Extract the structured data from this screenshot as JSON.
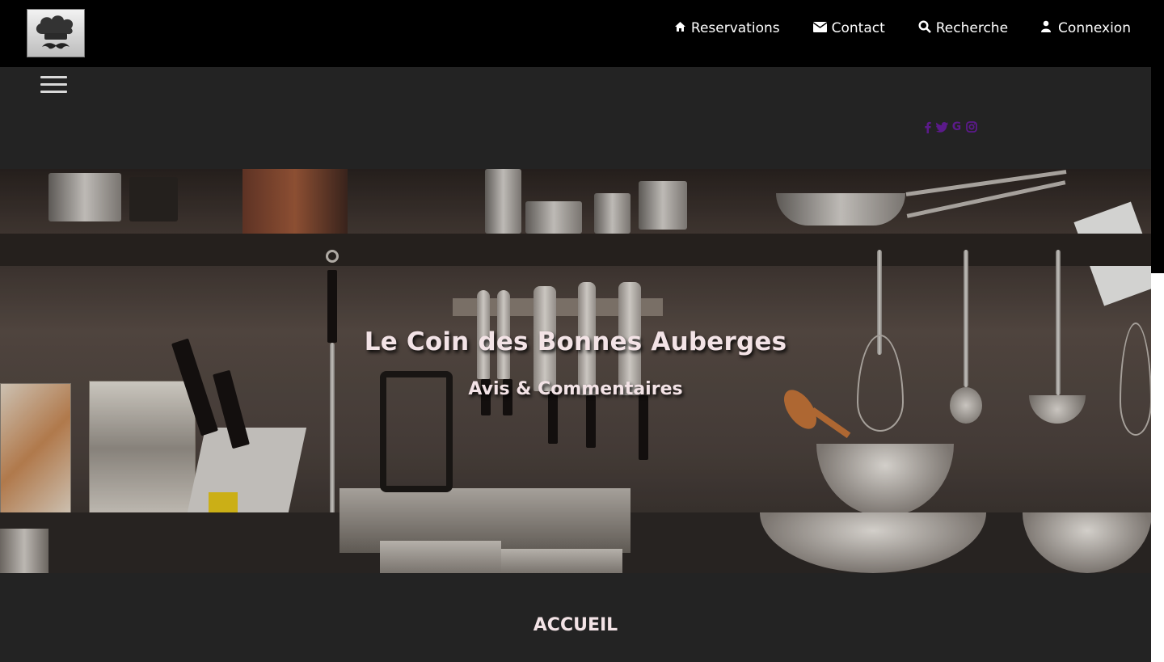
{
  "header": {
    "logo_alt": "chef-hat-mustache-logo",
    "nav": [
      {
        "label": "Reservations",
        "icon": "home-icon"
      },
      {
        "label": "Contact",
        "icon": "envelope-icon"
      },
      {
        "label": "Recherche",
        "icon": "search-icon"
      },
      {
        "label": "Connexion",
        "icon": "user-icon"
      }
    ]
  },
  "band": {
    "menu_icon": "hamburger-menu-icon",
    "social": [
      {
        "glyph": "f",
        "icon": "facebook-icon"
      },
      {
        "glyph": "🐦",
        "icon": "twitter-icon"
      },
      {
        "glyph": "G",
        "icon": "google-icon"
      },
      {
        "glyph": "◎",
        "icon": "instagram-icon"
      }
    ],
    "social_color": "#5b1a8a"
  },
  "hero": {
    "title": "Le Coin des Bonnes Auberges",
    "subtitle": "Avis & Commentaires"
  },
  "section": {
    "title": "ACCUEIL"
  },
  "colors": {
    "topbar": "#000000",
    "band": "#232323",
    "heading_text": "#f3e3e6"
  }
}
